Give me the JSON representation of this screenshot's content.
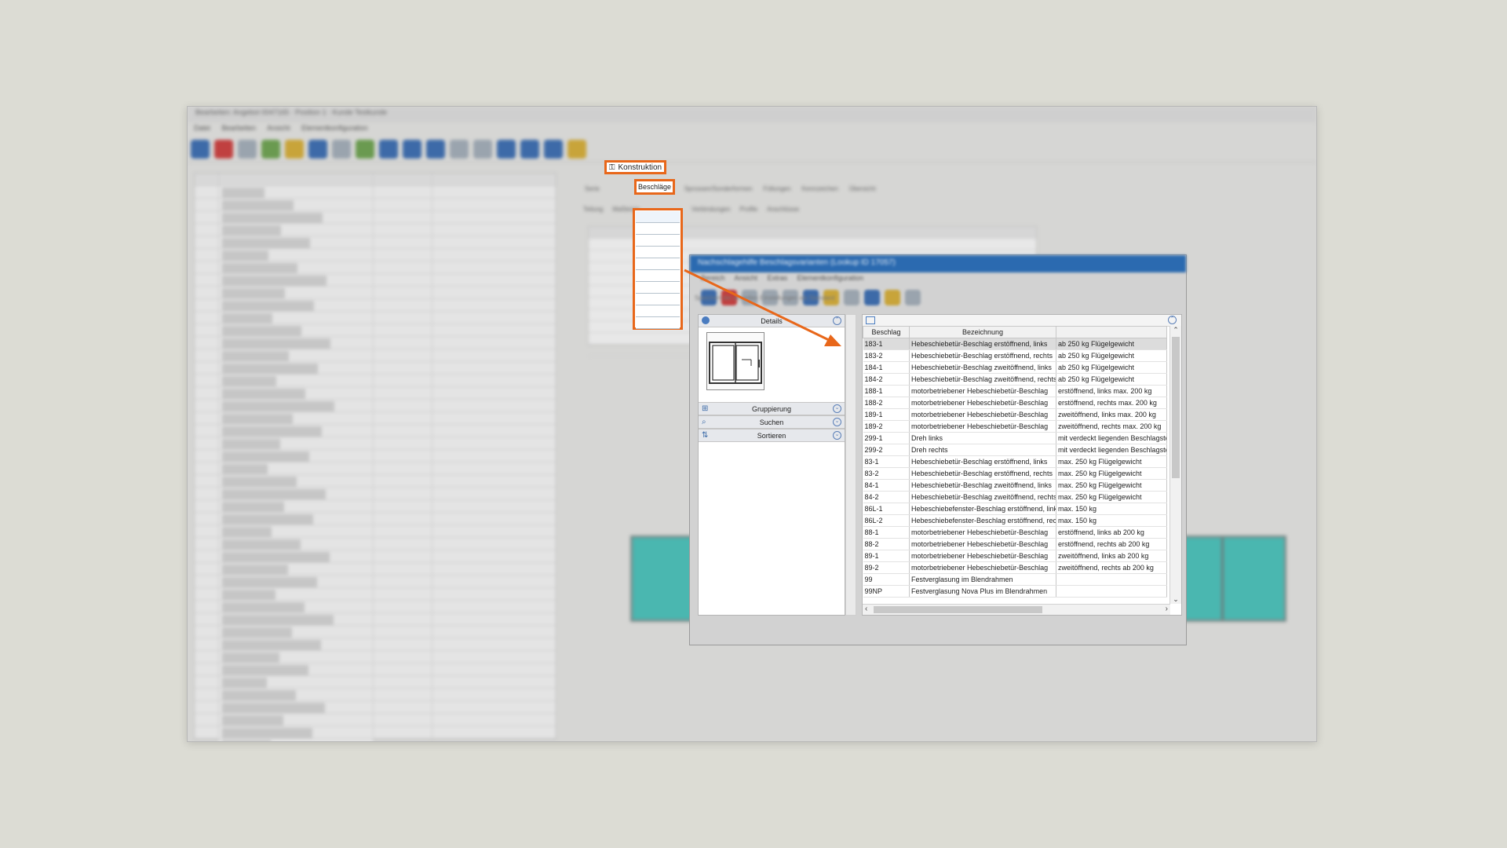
{
  "background": {
    "title": "Bearbeiten: Angebot 0047165 · Position 1 · Kunde Testkunde",
    "menu": [
      "Datei",
      "Bearbeiten",
      "Ansicht",
      "Elementkonfiguration"
    ],
    "tabs": [
      "Serie",
      "Konstruktion",
      "Sprossen/Sonderformen",
      "Füllungen",
      "Kennzeichen",
      "Übersicht"
    ],
    "subtabs": [
      "Teilung",
      "Maßleiste",
      "Beschläge",
      "Verbindungen",
      "Profile",
      "Anschlüsse"
    ],
    "highlight_tab": "Konstruktion",
    "highlight_subtab": "Beschläge",
    "accent_color": "#e8671a"
  },
  "dialog": {
    "title": "Nachschlagehilfe Beschlagsvarianten (Lookup ID 17057)",
    "menu": [
      "Bereich",
      "Ansicht",
      "Extras",
      "Elementkonfiguration"
    ],
    "status": "Speichert die aktuellen Einstellungen als Standard",
    "title_color": "#2b6ab0",
    "left_panel": {
      "header": "Details",
      "sections": [
        {
          "label": "Gruppierung",
          "icon": "grouping-icon"
        },
        {
          "label": "Suchen",
          "icon": "search-icon"
        },
        {
          "label": "Sortieren",
          "icon": "sort-icon"
        }
      ]
    },
    "grid": {
      "columns": [
        "Beschlag",
        "Bezeichnung",
        ""
      ],
      "rows": [
        [
          "183-1",
          "Hebeschiebetür-Beschlag erstöffnend, links",
          "ab 250 kg Flügelgewicht"
        ],
        [
          "183-2",
          "Hebeschiebetür-Beschlag erstöffnend, rechts",
          "ab 250 kg Flügelgewicht"
        ],
        [
          "184-1",
          "Hebeschiebetür-Beschlag zweitöffnend, links",
          "ab 250 kg Flügelgewicht"
        ],
        [
          "184-2",
          "Hebeschiebetür-Beschlag zweitöffnend, rechts",
          "ab 250 kg Flügelgewicht"
        ],
        [
          "188-1",
          "motorbetriebener Hebeschiebetür-Beschlag",
          "erstöffnend, links max. 200 kg"
        ],
        [
          "188-2",
          "motorbetriebener Hebeschiebetür-Beschlag",
          "erstöffnend, rechts max. 200 kg"
        ],
        [
          "189-1",
          "motorbetriebener Hebeschiebetür-Beschlag",
          "zweitöffnend, links max. 200 kg"
        ],
        [
          "189-2",
          "motorbetriebener Hebeschiebetür-Beschlag",
          "zweitöffnend, rechts max. 200 kg"
        ],
        [
          "299-1",
          "Dreh links",
          "mit verdeckt liegenden Beschlagsteilen"
        ],
        [
          "299-2",
          "Dreh rechts",
          "mit verdeckt liegenden Beschlagsteilen"
        ],
        [
          "83-1",
          "Hebeschiebetür-Beschlag erstöffnend, links",
          "max. 250 kg Flügelgewicht"
        ],
        [
          "83-2",
          "Hebeschiebetür-Beschlag erstöffnend, rechts",
          "max. 250 kg Flügelgewicht"
        ],
        [
          "84-1",
          "Hebeschiebetür-Beschlag zweitöffnend, links",
          "max. 250 kg Flügelgewicht"
        ],
        [
          "84-2",
          "Hebeschiebetür-Beschlag zweitöffnend, rechts",
          "max. 250 kg Flügelgewicht"
        ],
        [
          "86L-1",
          "Hebeschiebefenster-Beschlag erstöffnend, links",
          "max. 150 kg"
        ],
        [
          "86L-2",
          "Hebeschiebefenster-Beschlag erstöffnend, rechts",
          "max. 150 kg"
        ],
        [
          "88-1",
          "motorbetriebener Hebeschiebetür-Beschlag",
          "erstöffnend, links ab 200 kg"
        ],
        [
          "88-2",
          "motorbetriebener Hebeschiebetür-Beschlag",
          "erstöffnend, rechts ab 200 kg"
        ],
        [
          "89-1",
          "motorbetriebener Hebeschiebetür-Beschlag",
          "zweitöffnend, links ab 200 kg"
        ],
        [
          "89-2",
          "motorbetriebener Hebeschiebetür-Beschlag",
          "zweitöffnend, rechts ab 200 kg"
        ],
        [
          "99",
          "Festverglasung im Blendrahmen",
          ""
        ],
        [
          "99NP",
          "Festverglasung Nova Plus im Blendrahmen",
          ""
        ]
      ],
      "selected_row": 0
    }
  }
}
